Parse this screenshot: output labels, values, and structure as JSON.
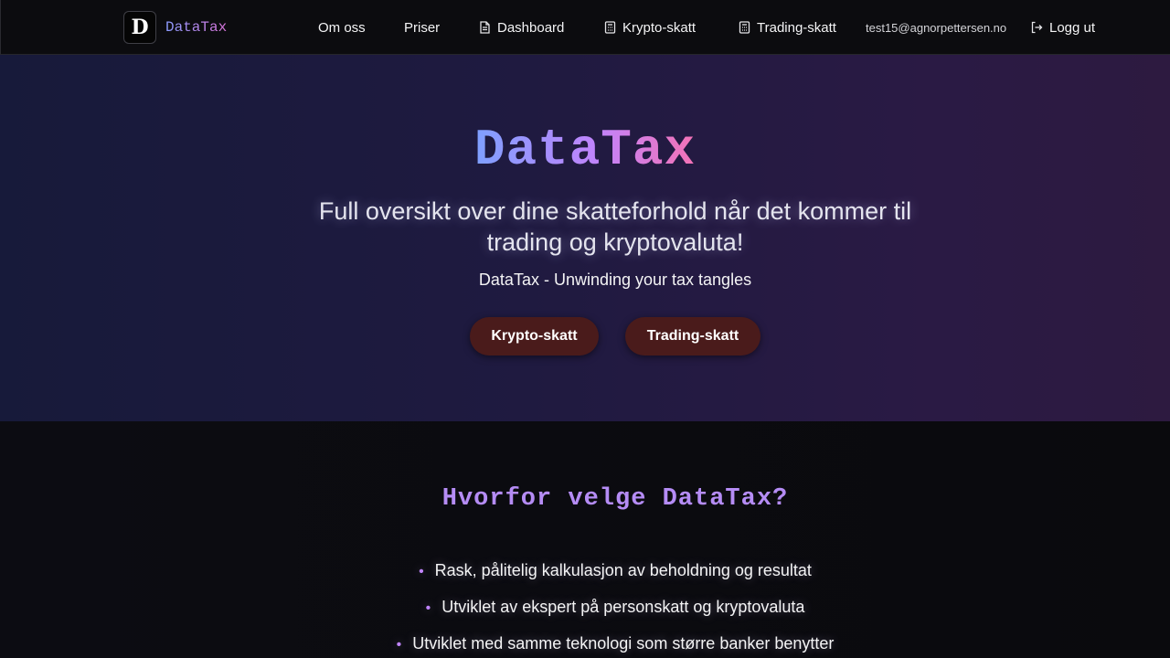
{
  "nav": {
    "logo_letter": "D",
    "brand": "DataTax",
    "links": {
      "about": "Om oss",
      "pricing": "Priser",
      "dashboard": "Dashboard",
      "crypto": "Krypto-skatt",
      "trading": "Trading-skatt"
    },
    "user_email": "test15@agnorpettersen.no",
    "logout": "Logg ut"
  },
  "hero": {
    "title": "DataTax",
    "subtitle": "Full oversikt over dine skatteforhold når det kommer til trading og kryptovaluta!",
    "tagline": "DataTax - Unwinding your tax tangles",
    "buttons": {
      "crypto": "Krypto-skatt",
      "trading": "Trading-skatt"
    }
  },
  "why": {
    "title": "Hvorfor velge DataTax?",
    "items": [
      "Rask, pålitelig kalkulasjon av beholdning og resultat",
      "Utviklet av ekspert på personskatt og kryptovaluta",
      "Utviklet med samme teknologi som større banker benytter"
    ]
  },
  "colors": {
    "accent_purple": "#c084fc",
    "button_bg": "#4a1b1b",
    "nav_bg": "#0c0c0f"
  },
  "icons": {
    "dashboard": "document-icon",
    "crypto": "calculator-icon",
    "trading": "calculator-icon",
    "logout": "logout-icon"
  }
}
